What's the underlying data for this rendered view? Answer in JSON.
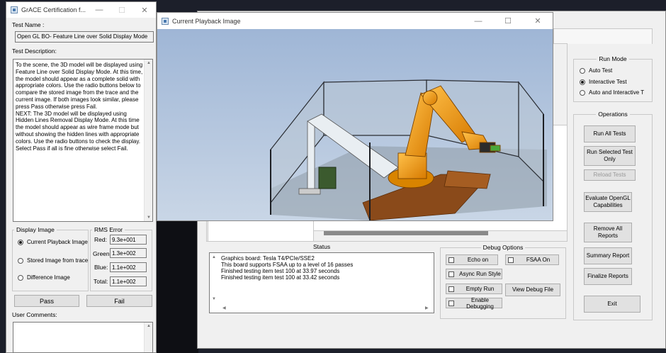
{
  "grace_window": {
    "title": "GrACE Certification f...",
    "test_name_label": "Test Name :",
    "test_name_value": "Open GL BO- Feature Line over Solid Display Mode",
    "test_desc_label": "Test Description:",
    "test_desc_text": "To the scene, the 3D model will be displayed using Feature Line over Solid Display Mode. At this time, the model should appear as a complete solid with appropriate colors. Use the radio buttons below to compare the stored image from the trace and the current image. If both images look similar, please press Pass otherwise press Fail.\nNEXT: The 3D model will be displayed using Hidden Lines Removal Display Mode. At this time the model should appear as wire frame mode but without showing the hidden lines with appropriate colors. Use the radio buttons to check the display. Select Pass if all is fine otherwise select Fail.",
    "display_image_label": "Display Image",
    "radio_current": "Current Playback Image",
    "radio_stored": "Stored Image from trace",
    "radio_difference": "Difference Image",
    "rms_label": "RMS Error",
    "red_label": "Red:",
    "red_value": "9.3e+001",
    "green_label": "Green:",
    "green_value": "1.3e+002",
    "blue_label": "Blue:",
    "blue_value": "1.1e+002",
    "total_label": "Total:",
    "total_value": "1.1e+002",
    "pass_label": "Pass",
    "fail_label": "Fail",
    "user_comments_label": "User Comments:"
  },
  "playback_window": {
    "title": "Current Playback Image"
  },
  "main_window": {
    "run_mode_label": "Run Mode",
    "run_mode_options": [
      "Auto Test",
      "Interactive Test",
      "Auto and Interactive T"
    ],
    "run_mode_selected": "Interactive Test",
    "operations_label": "Operations",
    "btn_run_all": "Run All Tests",
    "btn_run_selected": "Run Selected Test Only",
    "btn_reload": "Reload Tests",
    "btn_evaluate": "Evaluate OpenGL Capabilities",
    "btn_remove_all": "Remove All Reports",
    "btn_summary": "Summary Report",
    "btn_finalize": "Finalize Reports",
    "btn_exit": "Exit",
    "status_label": "Status",
    "status_lines": [
      "Graphics board: Tesla T4/PCIe/SSE2",
      "This board supports FSAA up to a level of 16 passes",
      "Finished testing item test 100 at 33.97 seconds",
      "Finished testing item test 100 at 33.42 seconds"
    ],
    "debug_options_label": "Debug Options",
    "chk_echo": "Echo on",
    "chk_fsaa": "FSAA On",
    "chk_async": "Async Run Style",
    "chk_empty": "Empty Run",
    "chk_enable_debug": "Enable Debugging",
    "btn_view_debug": "View Debug File"
  },
  "colors": {
    "viewport_sky": "#bfcde0",
    "robot_orange": "#f09b10",
    "floor_grey": "#9aa4ad"
  }
}
